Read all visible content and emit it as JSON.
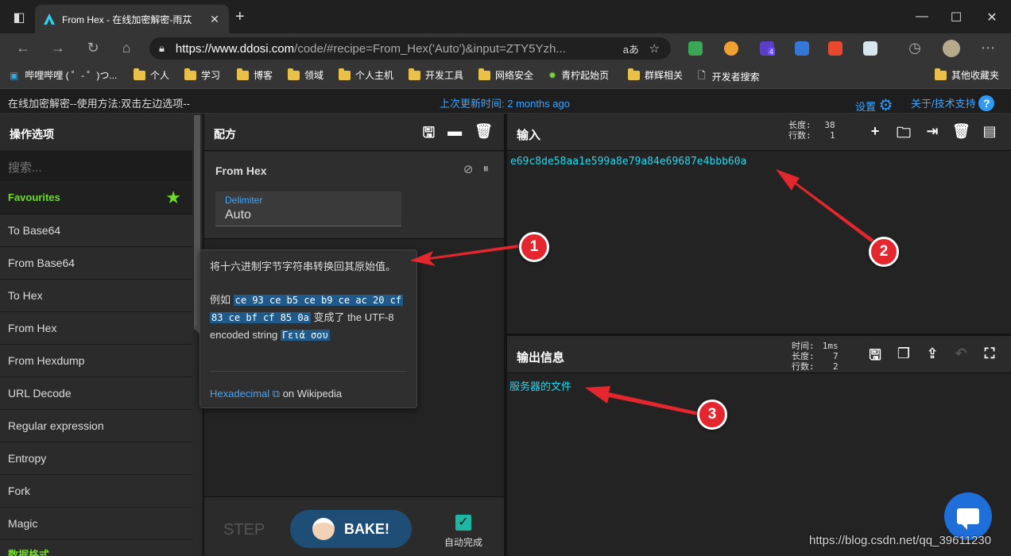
{
  "browser": {
    "tab_title": "From Hex - 在线加密解密-雨苁",
    "url_host": "https://www.ddosi.com",
    "url_path": "/code/#recipe=From_Hex('Auto')&input=ZTY5Yzh...",
    "read_aloud": "aあ",
    "extension_badge": "4",
    "bookmarks": [
      "哔哩哔哩 ( ゜- ゜)つ...",
      "个人",
      "学习",
      "博客",
      "领域",
      "个人主机",
      "开发工具",
      "网络安全",
      "青柠起始页",
      "群辉相关",
      "开发者搜索"
    ],
    "other_bookmarks": "其他收藏夹"
  },
  "appbar": {
    "left": "在线加密解密--使用方法:双击左边选项--",
    "updated": "上次更新时间: 2 months ago",
    "settings": "设置",
    "about": "关于/技术支持"
  },
  "operations": {
    "title": "操作选项",
    "search_placeholder": "搜索...",
    "favourites": "Favourites",
    "items": [
      "To Base64",
      "From Base64",
      "To Hex",
      "From Hex",
      "From Hexdump",
      "URL Decode",
      "Regular expression",
      "Entropy",
      "Fork",
      "Magic"
    ],
    "next_category": "数据格式"
  },
  "recipe": {
    "title": "配方",
    "op_name": "From Hex",
    "delimiter_label": "Delimiter",
    "delimiter_value": "Auto",
    "step": "STEP",
    "bake": "BAKE!",
    "autobake": "自动完成"
  },
  "tooltip": {
    "line1": "将十六进制字节字符串转换回其原始值。",
    "example_prefix": "例如",
    "example_code1": "ce 93 ce b5 ce b9 ce ac 20 cf",
    "example_code2": "83 ce bf cf 85 0a",
    "example_mid": "变成了 the UTF-8 encoded string",
    "example_result": "Γειά σου",
    "link": "Hexadecimal",
    "link_suffix": "on Wikipedia"
  },
  "input": {
    "title": "输入",
    "length_label": "长度:",
    "length": "38",
    "lines_label": "行数:",
    "lines": "1",
    "text": "e69c8de58aa1e599a8e79a84e69687e4bbb60a"
  },
  "output": {
    "title": "输出信息",
    "time_label": "时间:",
    "time": "1ms",
    "length_label": "长度:",
    "length": "7",
    "lines_label": "行数:",
    "lines": "2",
    "text": "服务器的文件"
  },
  "annotations": [
    "1",
    "2",
    "3"
  ],
  "watermark": "https://blog.csdn.net/qq_39611230",
  "colors": {
    "accent": "#3ea6ff",
    "favourite": "#6fdb2b",
    "arrow": "#e4262e",
    "text_cyan": "#21d9ef"
  }
}
